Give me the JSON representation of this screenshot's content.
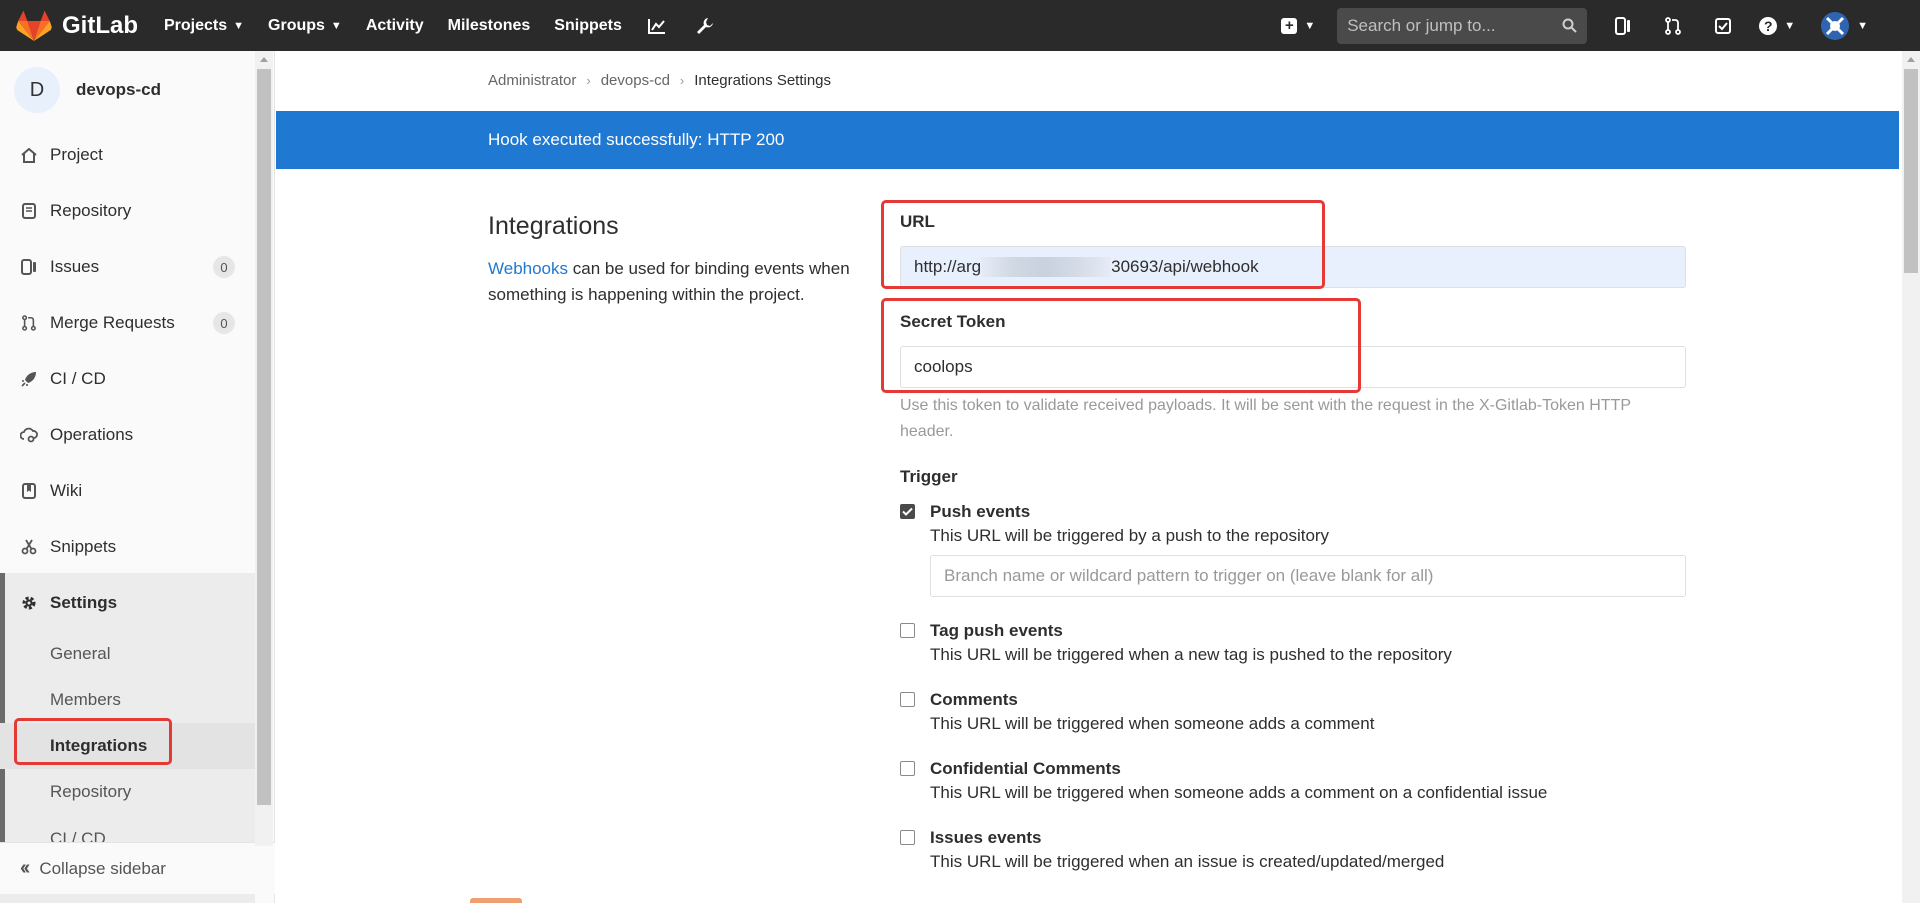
{
  "navbar": {
    "brand": "GitLab",
    "links": [
      {
        "label": "Projects",
        "dropdown": true
      },
      {
        "label": "Groups",
        "dropdown": true
      },
      {
        "label": "Activity",
        "dropdown": false
      },
      {
        "label": "Milestones",
        "dropdown": false
      },
      {
        "label": "Snippets",
        "dropdown": false
      }
    ],
    "search_placeholder": "Search or jump to..."
  },
  "sidebar": {
    "project_initial": "D",
    "project_name": "devops-cd",
    "items": [
      {
        "label": "Project",
        "icon": "home-icon"
      },
      {
        "label": "Repository",
        "icon": "doc-icon"
      },
      {
        "label": "Issues",
        "icon": "issues-icon",
        "count": "0"
      },
      {
        "label": "Merge Requests",
        "icon": "merge-request-icon",
        "count": "0"
      },
      {
        "label": "CI / CD",
        "icon": "rocket-icon"
      },
      {
        "label": "Operations",
        "icon": "cloud-gear-icon"
      },
      {
        "label": "Wiki",
        "icon": "book-icon"
      },
      {
        "label": "Snippets",
        "icon": "scissors-icon"
      },
      {
        "label": "Settings",
        "icon": "gear-icon"
      }
    ],
    "settings_sub": [
      "General",
      "Members",
      "Integrations",
      "Repository",
      "CI / CD"
    ],
    "collapse_label": "Collapse sidebar"
  },
  "breadcrumb": [
    "Administrator",
    "devops-cd",
    "Integrations Settings"
  ],
  "flash": "Hook executed successfully: HTTP 200",
  "section": {
    "title": "Integrations",
    "link": "Webhooks",
    "desc": " can be used for binding events when something is happening within the project."
  },
  "form": {
    "url_label": "URL",
    "url_prefix": "http://arg",
    "url_suffix": "30693/api/webhook",
    "token_label": "Secret Token",
    "token_value": "coolops",
    "token_help": "Use this token to validate received payloads. It will be sent with the request in the X-Gitlab-Token HTTP header.",
    "trigger_label": "Trigger",
    "branch_placeholder": "Branch name or wildcard pattern to trigger on (leave blank for all)",
    "triggers": [
      {
        "title": "Push events",
        "desc": "This URL will be triggered by a push to the repository",
        "checked": true
      },
      {
        "title": "Tag push events",
        "desc": "This URL will be triggered when a new tag is pushed to the repository",
        "checked": false
      },
      {
        "title": "Comments",
        "desc": "This URL will be triggered when someone adds a comment",
        "checked": false
      },
      {
        "title": "Confidential Comments",
        "desc": "This URL will be triggered when someone adds a comment on a confidential issue",
        "checked": false
      },
      {
        "title": "Issues events",
        "desc": "This URL will be triggered when an issue is created/updated/merged",
        "checked": false
      }
    ]
  },
  "colors": {
    "navbar": "#2a2a2a",
    "flash": "#1f78d1",
    "highlight": "#e53935",
    "link": "#1f78d1"
  }
}
